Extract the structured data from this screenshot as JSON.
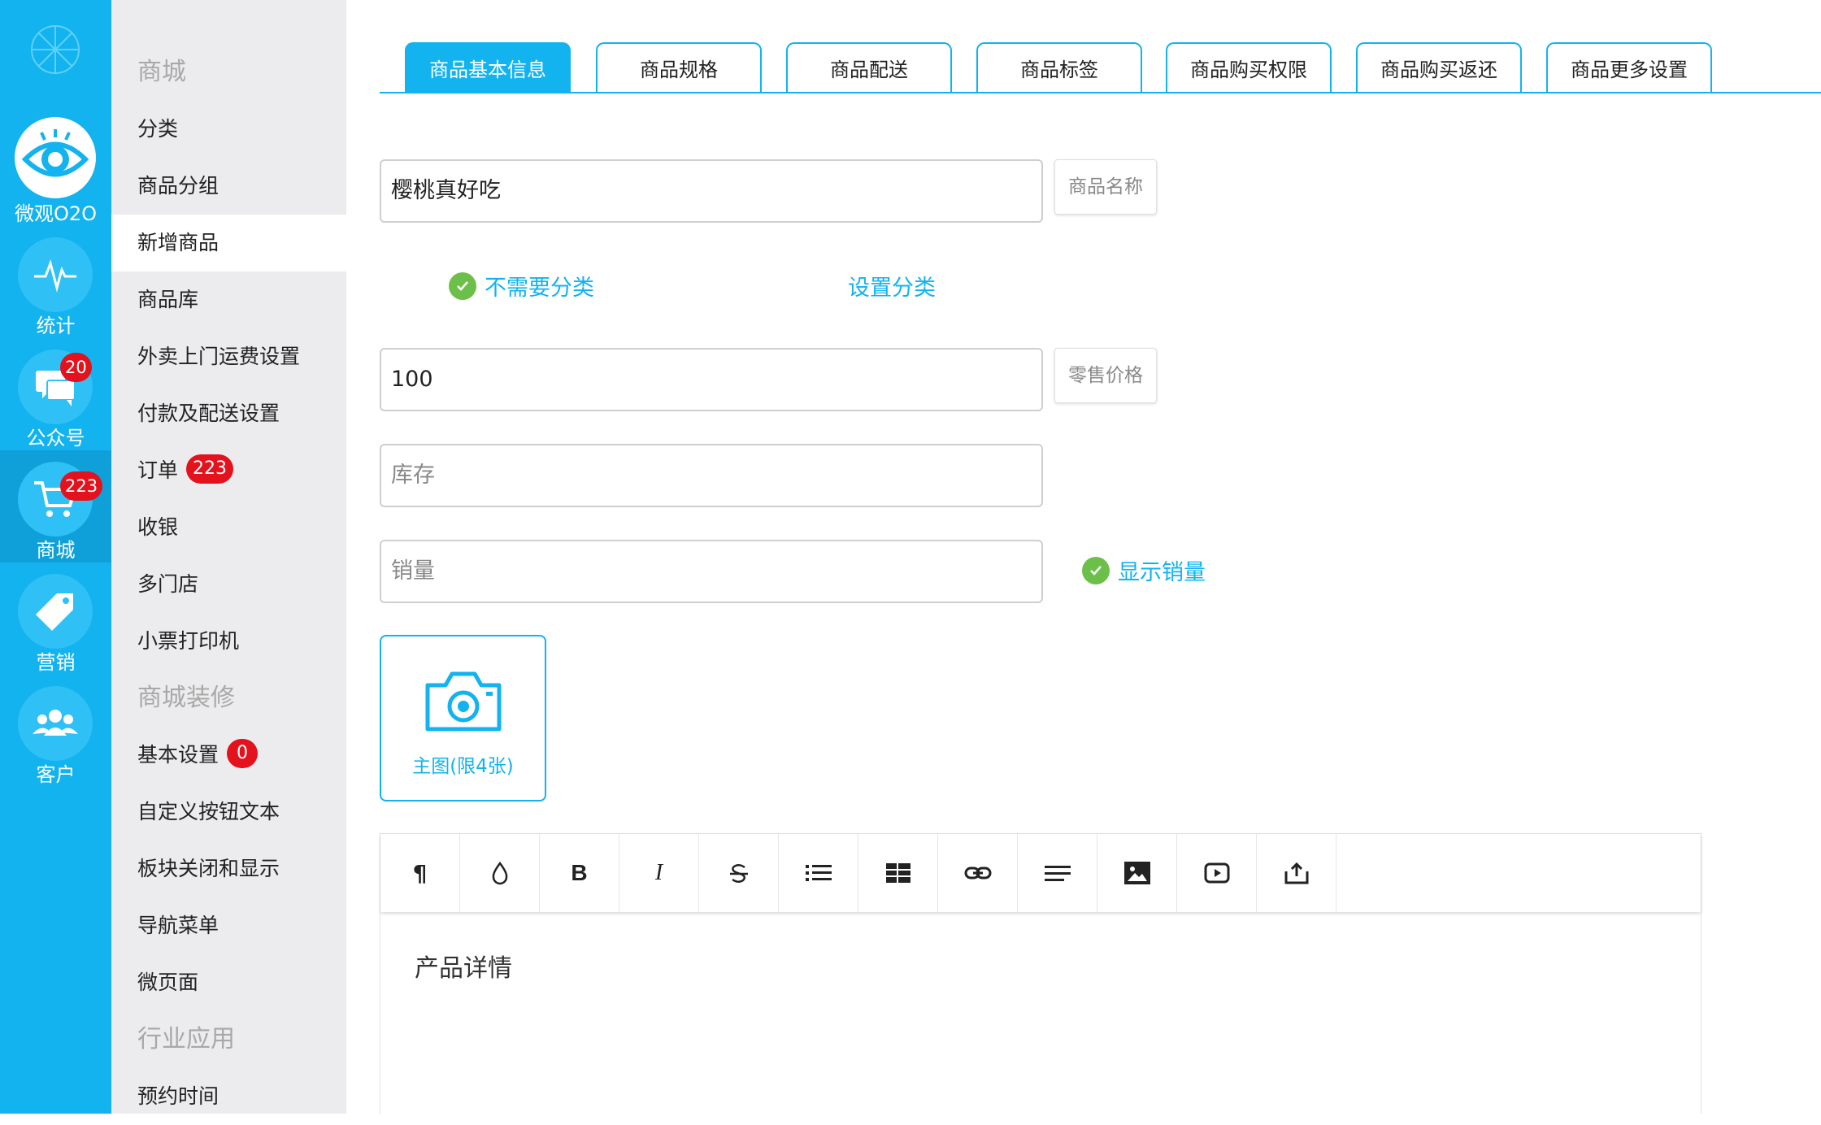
{
  "rail": {
    "items": [
      {
        "label": "微观O2O",
        "icon": "eye-icon",
        "badge": null
      },
      {
        "label": "统计",
        "icon": "pulse-icon",
        "badge": null
      },
      {
        "label": "公众号",
        "icon": "chat-icon",
        "badge": "20"
      },
      {
        "label": "商城",
        "icon": "cart-icon",
        "badge": "223"
      },
      {
        "label": "营销",
        "icon": "tag-icon",
        "badge": null
      },
      {
        "label": "客户",
        "icon": "users-icon",
        "badge": null
      }
    ],
    "active": "商城",
    "color": "#12b3ef"
  },
  "menu": {
    "items": [
      {
        "label": "商城",
        "type": "section"
      },
      {
        "label": "分类"
      },
      {
        "label": "商品分组"
      },
      {
        "label": "新增商品",
        "active": true
      },
      {
        "label": "商品库"
      },
      {
        "label": "外卖上门运费设置"
      },
      {
        "label": "付款及配送设置"
      },
      {
        "label": "订单",
        "badge": "223"
      },
      {
        "label": "收银"
      },
      {
        "label": "多门店"
      },
      {
        "label": "小票打印机"
      },
      {
        "label": "商城装修",
        "type": "section"
      },
      {
        "label": "基本设置",
        "badge": "0"
      },
      {
        "label": "自定义按钮文本"
      },
      {
        "label": "板块关闭和显示"
      },
      {
        "label": "导航菜单"
      },
      {
        "label": "微页面"
      },
      {
        "label": "行业应用",
        "type": "section"
      },
      {
        "label": "预约时间"
      }
    ]
  },
  "tabs": [
    {
      "label": "商品基本信息",
      "active": true
    },
    {
      "label": "商品规格"
    },
    {
      "label": "商品配送"
    },
    {
      "label": "商品标签"
    },
    {
      "label": "商品购买权限"
    },
    {
      "label": "商品购买返还"
    },
    {
      "label": "商品更多设置"
    }
  ],
  "form": {
    "name_value": "樱桃真好吃",
    "name_tag": "商品名称",
    "no_category_label": "不需要分类",
    "set_category_label": "设置分类",
    "price_value": "100",
    "price_tag": "零售价格",
    "stock_placeholder": "库存",
    "sales_placeholder": "销量",
    "show_sales_label": "显示销量",
    "upload_label": "主图(限4张)"
  },
  "editor": {
    "tools": [
      "paragraph-icon",
      "color-drop-icon",
      "bold-icon",
      "italic-icon",
      "strikethrough-icon",
      "list-icon",
      "table-icon",
      "link-icon",
      "align-icon",
      "image-icon",
      "video-icon",
      "upload-icon"
    ],
    "bold_glyph": "B",
    "italic_glyph": "I",
    "paragraph_glyph": "¶",
    "body_placeholder": "产品详情"
  }
}
